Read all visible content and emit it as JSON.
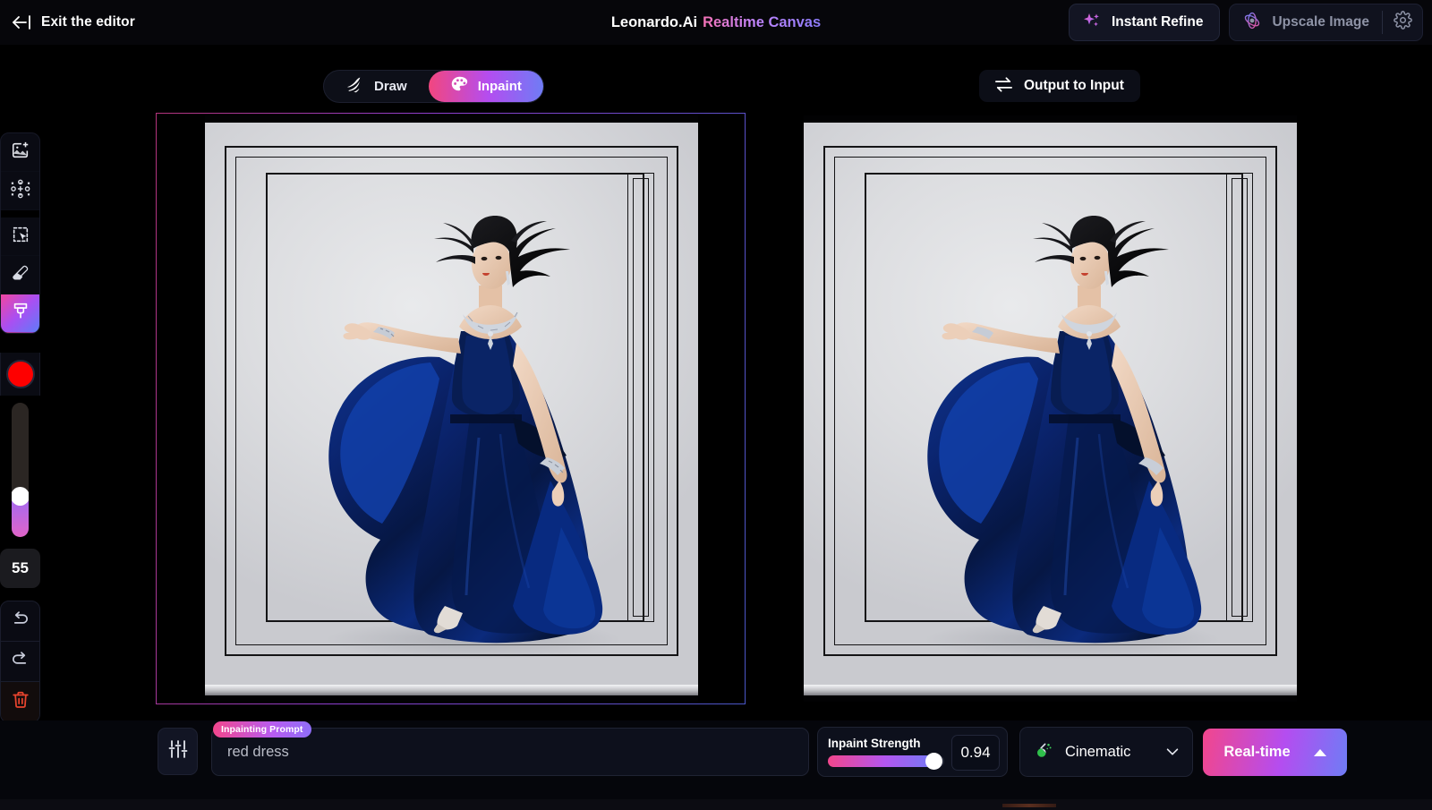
{
  "topbar": {
    "exit_label": "Exit the editor",
    "exit_icon": "arrow-left-bar-icon",
    "title_primary": "Leonardo.Ai",
    "title_secondary": "Realtime Canvas",
    "instant_refine_label": "Instant Refine",
    "instant_refine_icon": "sparkles-icon",
    "upscale_label": "Upscale Image",
    "upscale_icon": "atom-icon",
    "settings_icon": "gear-icon"
  },
  "modes": {
    "draw_label": "Draw",
    "draw_icon": "brush-stroke-icon",
    "inpaint_label": "Inpaint",
    "inpaint_icon": "palette-icon",
    "active": "Inpaint",
    "output_to_input_label": "Output to Input",
    "output_to_input_icon": "swap-arrows-icon"
  },
  "toolbar": {
    "tools": [
      {
        "name": "add-image-tool",
        "icon": "image-plus-icon",
        "active": false
      },
      {
        "name": "pattern-tool",
        "icon": "dots-grid-plus-icon",
        "active": false
      },
      {
        "name": "select-tool",
        "icon": "marquee-cursor-icon",
        "active": false
      },
      {
        "name": "eraser-tool",
        "icon": "eraser-icon",
        "active": false
      },
      {
        "name": "brush-tool",
        "icon": "paintbrush-icon",
        "active": true
      }
    ],
    "color": "#fe0000",
    "brush_size": "55",
    "undo_icon": "undo-arrow-icon",
    "redo_icon": "redo-arrow-icon",
    "delete_icon": "trash-icon"
  },
  "canvas": {
    "left_panel_name": "input-canvas",
    "right_panel_name": "output-canvas",
    "selection_color": "#b4347c"
  },
  "bottombar": {
    "adjust_icon": "sliders-icon",
    "prompt_badge": "Inpainting Prompt",
    "prompt_value": "red dress",
    "prompt_placeholder": "red dress",
    "strength_label": "Inpaint Strength",
    "strength_value": "0.94",
    "strength_percent": 94,
    "style_value": "Cinematic",
    "style_icon": "flask-icon",
    "style_chevron_icon": "chevron-down-icon",
    "realtime_label": "Real-time",
    "realtime_caret_icon": "caret-up-icon"
  }
}
